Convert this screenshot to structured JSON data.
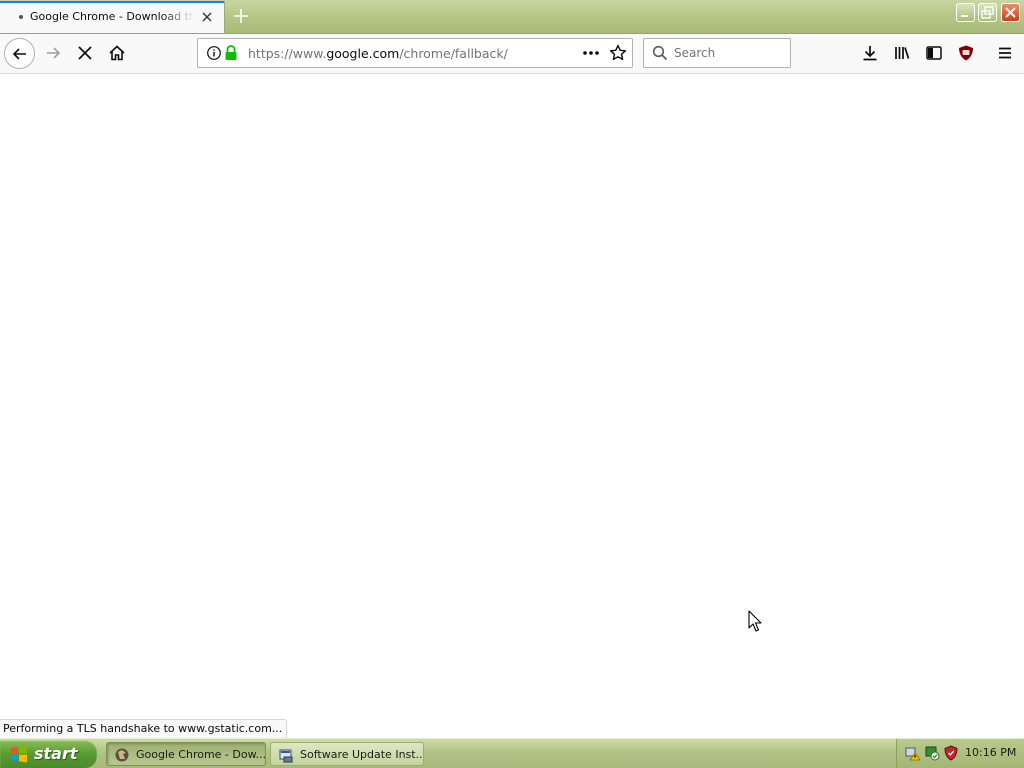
{
  "browser": {
    "tab": {
      "title": "Google Chrome - Download the Fast, Secure Browser from Google"
    },
    "urlbar": {
      "url_prefix": "https://www.",
      "url_host": "google.com",
      "url_path": "/chrome/fallback/"
    },
    "searchbar": {
      "placeholder": "Search"
    },
    "status_text": "Performing a TLS handshake to www.gstatic.com..."
  },
  "icons": {
    "back": "back-arrow-icon",
    "forward": "forward-arrow-icon",
    "stop": "stop-icon",
    "home": "home-icon",
    "info": "info-icon",
    "lock": "lock-icon",
    "more": "ellipsis-icon",
    "bookmark": "star-icon",
    "search": "magnifier-icon",
    "downloads": "download-icon",
    "library": "library-icon",
    "sidebar": "sidebar-icon",
    "ublock": "ublock-origin-icon",
    "menu": "hamburger-icon"
  },
  "taskbar": {
    "start_label": "start",
    "tasks": [
      {
        "label": "Google Chrome - Dow..."
      },
      {
        "label": "Software Update Inst..."
      }
    ],
    "clock": "10:16 PM"
  },
  "colors": {
    "accent": "#0a84ff",
    "lock_green": "#12bc00",
    "xp_start_green": "#5a9a33",
    "ublock_red": "#800000"
  }
}
